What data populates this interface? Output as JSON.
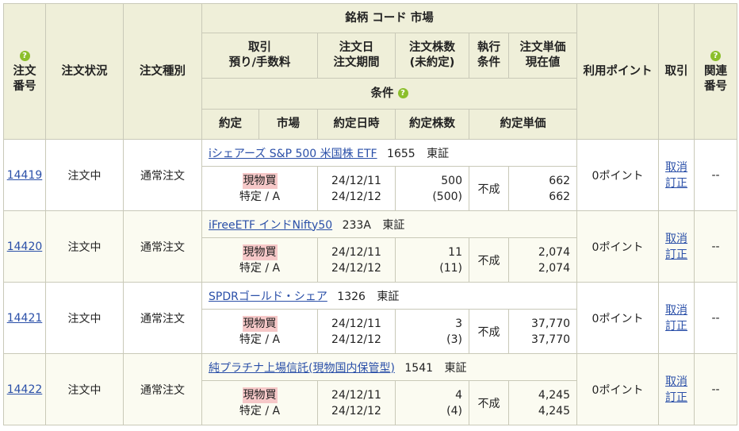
{
  "header": {
    "order_no": "注文番号",
    "order_no_l1": "注文",
    "order_no_l2": "番号",
    "status": "注文状況",
    "type": "注文種別",
    "brand": "銘柄 コード 市場",
    "trade_l1": "取引",
    "trade_l2": "預り/手数料",
    "order_date_l1": "注文日",
    "order_date_l2": "注文期間",
    "qty_l1": "注文株数",
    "qty_l2": "(未約定)",
    "exec_l1": "執行",
    "exec_l2": "条件",
    "price_l1": "注文単価",
    "price_l2": "現在値",
    "condition": "条件",
    "fill": "約定",
    "market": "市場",
    "fill_date": "約定日時",
    "fill_qty": "約定株数",
    "fill_price": "約定単価",
    "points": "利用ポイント",
    "action": "取引",
    "related_l1": "関連",
    "related_l2": "番号",
    "help_icon": "?"
  },
  "orders": [
    {
      "no": "14419",
      "status": "注文中",
      "type": "通常注文",
      "name": "iシェアーズ S&P 500 米国株 ETF",
      "code": "1655",
      "market": "東証",
      "side": "現物買",
      "account": "特定 / A",
      "order_date": "24/12/11",
      "period": "24/12/12",
      "qty": "500",
      "unfilled": "(500)",
      "exec": "不成",
      "price": "662",
      "current": "662",
      "points": "0ポイント",
      "cancel": "取消",
      "modify": "訂正",
      "related": "--"
    },
    {
      "no": "14420",
      "status": "注文中",
      "type": "通常注文",
      "name": "iFreeETF インドNifty50",
      "code": "233A",
      "market": "東証",
      "side": "現物買",
      "account": "特定 / A",
      "order_date": "24/12/11",
      "period": "24/12/12",
      "qty": "11",
      "unfilled": "(11)",
      "exec": "不成",
      "price": "2,074",
      "current": "2,074",
      "points": "0ポイント",
      "cancel": "取消",
      "modify": "訂正",
      "related": "--"
    },
    {
      "no": "14421",
      "status": "注文中",
      "type": "通常注文",
      "name": "SPDRゴールド・シェア",
      "code": "1326",
      "market": "東証",
      "side": "現物買",
      "account": "特定 / A",
      "order_date": "24/12/11",
      "period": "24/12/12",
      "qty": "3",
      "unfilled": "(3)",
      "exec": "不成",
      "price": "37,770",
      "current": "37,770",
      "points": "0ポイント",
      "cancel": "取消",
      "modify": "訂正",
      "related": "--"
    },
    {
      "no": "14422",
      "status": "注文中",
      "type": "通常注文",
      "name": "純プラチナ上場信託(現物国内保管型)",
      "code": "1541",
      "market": "東証",
      "side": "現物買",
      "account": "特定 / A",
      "order_date": "24/12/11",
      "period": "24/12/12",
      "qty": "4",
      "unfilled": "(4)",
      "exec": "不成",
      "price": "4,245",
      "current": "4,245",
      "points": "0ポイント",
      "cancel": "取消",
      "modify": "訂正",
      "related": "--"
    }
  ],
  "colors": {
    "header_bg": "#efefd9",
    "border": "#c9c9b8",
    "link": "#2a4fa8",
    "buy_bg": "#f6c8c8",
    "help_icon": "#8cbf2c"
  }
}
